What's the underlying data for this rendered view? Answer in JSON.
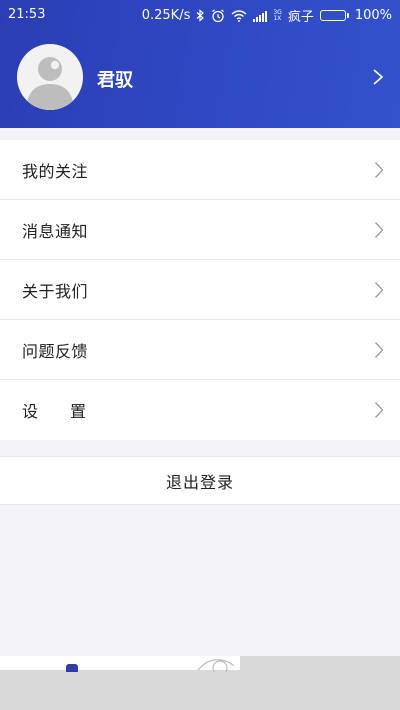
{
  "status_bar": {
    "time": "21:53",
    "speed": "0.25K/s",
    "network_small": "3G",
    "network_small2": "1X",
    "carrier": "疯子",
    "battery": "100%",
    "battery_level": 1.0,
    "icons": [
      "bluetooth-icon",
      "alarm-icon",
      "wifi-icon",
      "signal-icon",
      "battery-icon"
    ]
  },
  "profile": {
    "username": "君驭",
    "avatar_icon": "user-avatar-icon"
  },
  "menu": {
    "items": [
      {
        "label": "我的关注"
      },
      {
        "label": "消息通知"
      },
      {
        "label": "关于我们"
      },
      {
        "label": "问题反馈"
      },
      {
        "label": "设　　置"
      }
    ]
  },
  "logout": {
    "label": "退出登录"
  },
  "colors": {
    "header_start": "#2b3db4",
    "header_end": "#3352cc",
    "background": "#f4f4f8",
    "divider": "#e8e8ec",
    "chevron": "#9a9a9a"
  }
}
